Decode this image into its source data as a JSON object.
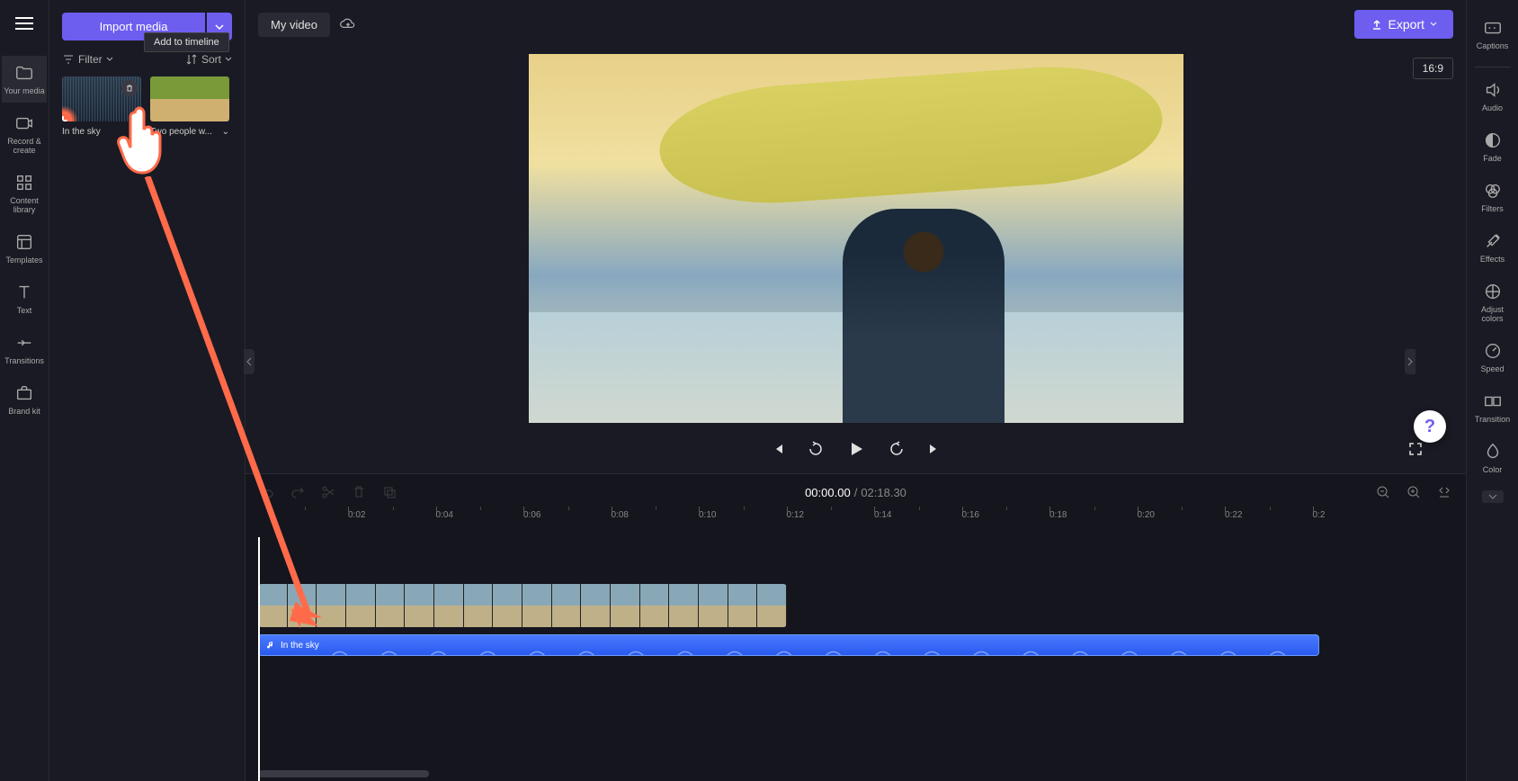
{
  "leftRail": {
    "items": [
      {
        "label": "Your media",
        "active": true
      },
      {
        "label": "Record & create"
      },
      {
        "label": "Content library"
      },
      {
        "label": "Templates"
      },
      {
        "label": "Text"
      },
      {
        "label": "Transitions"
      },
      {
        "label": "Brand kit"
      }
    ]
  },
  "mediaPanel": {
    "importLabel": "Import media",
    "filterLabel": "Filter",
    "sortLabel": "Sort",
    "addTooltip": "Add to timeline",
    "items": [
      {
        "name": "In the sky",
        "type": "audio"
      },
      {
        "name": "Two people w...",
        "type": "video"
      }
    ]
  },
  "topBar": {
    "title": "My video",
    "exportLabel": "Export",
    "aspectRatio": "16:9"
  },
  "playback": {
    "current": "00:00.00",
    "total": "02:18.30"
  },
  "rightRail": {
    "items": [
      {
        "label": "Captions"
      },
      {
        "label": "Audio"
      },
      {
        "label": "Fade"
      },
      {
        "label": "Filters"
      },
      {
        "label": "Effects"
      },
      {
        "label": "Adjust colors"
      },
      {
        "label": "Speed"
      },
      {
        "label": "Transition"
      },
      {
        "label": "Color"
      }
    ]
  },
  "timeline": {
    "ticks": [
      "0:02",
      "0:04",
      "0:06",
      "0:08",
      "0:10",
      "0:12",
      "0:14",
      "0:16",
      "0:18",
      "0:20",
      "0:22",
      "0:2"
    ],
    "audioClipLabel": "In the sky"
  },
  "help": "?"
}
